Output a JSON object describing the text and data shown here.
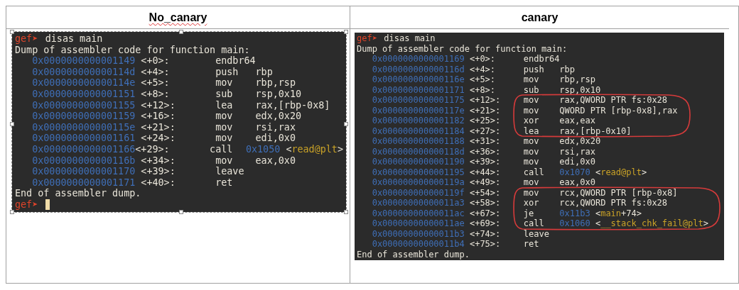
{
  "table": {
    "columns": [
      {
        "heading": "No_canary",
        "misspelled": true
      },
      {
        "heading": "canary",
        "misspelled": false
      }
    ],
    "panels": [
      {
        "lines": [
          {
            "kind": "prompt",
            "prompt": "gef➤",
            "command": "disas main"
          },
          {
            "kind": "text",
            "text": "Dump of assembler code for function main:"
          },
          {
            "kind": "instr",
            "addr": "0x0000000000001149",
            "offset": "<+0>:",
            "mnemonic": "endbr64"
          },
          {
            "kind": "instr",
            "addr": "0x000000000000114d",
            "offset": "<+4>:",
            "mnemonic": "push",
            "operands": "rbp"
          },
          {
            "kind": "instr",
            "addr": "0x000000000000114e",
            "offset": "<+5>:",
            "mnemonic": "mov",
            "operands": "rbp,rsp"
          },
          {
            "kind": "instr",
            "addr": "0x0000000000001151",
            "offset": "<+8>:",
            "mnemonic": "sub",
            "operands": "rsp,0x10"
          },
          {
            "kind": "instr",
            "addr": "0x0000000000001155",
            "offset": "<+12>:",
            "mnemonic": "lea",
            "operands": "rax,[rbp-0x8]"
          },
          {
            "kind": "instr",
            "addr": "0x0000000000001159",
            "offset": "<+16>:",
            "mnemonic": "mov",
            "operands": "edx,0x20"
          },
          {
            "kind": "instr",
            "addr": "0x000000000000115e",
            "offset": "<+21>:",
            "mnemonic": "mov",
            "operands": "rsi,rax"
          },
          {
            "kind": "instr",
            "addr": "0x0000000000001161",
            "offset": "<+24>:",
            "mnemonic": "mov",
            "operands": "edi,0x0"
          },
          {
            "kind": "instr",
            "addr": "0x0000000000001166",
            "offset": "<+29>:",
            "mnemonic": "call",
            "target": "0x1050",
            "ref_pre": "<",
            "ref_name": "read@plt",
            "ref_post": ">"
          },
          {
            "kind": "instr",
            "addr": "0x000000000000116b",
            "offset": "<+34>:",
            "mnemonic": "mov",
            "operands": "eax,0x0"
          },
          {
            "kind": "instr",
            "addr": "0x0000000000001170",
            "offset": "<+39>:",
            "mnemonic": "leave"
          },
          {
            "kind": "instr",
            "addr": "0x0000000000001171",
            "offset": "<+40>:",
            "mnemonic": "ret"
          },
          {
            "kind": "text",
            "text": "End of assembler dump."
          },
          {
            "kind": "prompt",
            "prompt": "gef➤",
            "cursor": true
          }
        ]
      },
      {
        "lines": [
          {
            "kind": "prompt",
            "prompt": "gef➤",
            "command": "disas main"
          },
          {
            "kind": "text",
            "text": "Dump of assembler code for function main:"
          },
          {
            "kind": "instr",
            "addr": "0x0000000000001169",
            "offset": "<+0>:",
            "mnemonic": "endbr64"
          },
          {
            "kind": "instr",
            "addr": "0x000000000000116d",
            "offset": "<+4>:",
            "mnemonic": "push",
            "operands": "rbp"
          },
          {
            "kind": "instr",
            "addr": "0x000000000000116e",
            "offset": "<+5>:",
            "mnemonic": "mov",
            "operands": "rbp,rsp"
          },
          {
            "kind": "instr",
            "addr": "0x0000000000001171",
            "offset": "<+8>:",
            "mnemonic": "sub",
            "operands": "rsp,0x10"
          },
          {
            "kind": "instr",
            "addr": "0x0000000000001175",
            "offset": "<+12>:",
            "mnemonic": "mov",
            "operands": "rax,QWORD PTR fs:0x28"
          },
          {
            "kind": "instr",
            "addr": "0x000000000000117e",
            "offset": "<+21>:",
            "mnemonic": "mov",
            "operands": "QWORD PTR [rbp-0x8],rax"
          },
          {
            "kind": "instr",
            "addr": "0x0000000000001182",
            "offset": "<+25>:",
            "mnemonic": "xor",
            "operands": "eax,eax"
          },
          {
            "kind": "instr",
            "addr": "0x0000000000001184",
            "offset": "<+27>:",
            "mnemonic": "lea",
            "operands": "rax,[rbp-0x10]"
          },
          {
            "kind": "instr",
            "addr": "0x0000000000001188",
            "offset": "<+31>:",
            "mnemonic": "mov",
            "operands": "edx,0x20"
          },
          {
            "kind": "instr",
            "addr": "0x000000000000118d",
            "offset": "<+36>:",
            "mnemonic": "mov",
            "operands": "rsi,rax"
          },
          {
            "kind": "instr",
            "addr": "0x0000000000001190",
            "offset": "<+39>:",
            "mnemonic": "mov",
            "operands": "edi,0x0"
          },
          {
            "kind": "instr",
            "addr": "0x0000000000001195",
            "offset": "<+44>:",
            "mnemonic": "call",
            "target": "0x1070",
            "ref_pre": "<",
            "ref_name": "read@plt",
            "ref_post": ">"
          },
          {
            "kind": "instr",
            "addr": "0x000000000000119a",
            "offset": "<+49>:",
            "mnemonic": "mov",
            "operands": "eax,0x0"
          },
          {
            "kind": "instr",
            "addr": "0x000000000000119f",
            "offset": "<+54>:",
            "mnemonic": "mov",
            "operands": "rcx,QWORD PTR [rbp-0x8]"
          },
          {
            "kind": "instr",
            "addr": "0x00000000000011a3",
            "offset": "<+58>:",
            "mnemonic": "xor",
            "operands": "rcx,QWORD PTR fs:0x28"
          },
          {
            "kind": "instr",
            "addr": "0x00000000000011ac",
            "offset": "<+67>:",
            "mnemonic": "je",
            "target": "0x11b3",
            "ref_pre": "<",
            "ref_name": "main",
            "ref_post": "+74>"
          },
          {
            "kind": "instr",
            "addr": "0x00000000000011ae",
            "offset": "<+69>:",
            "mnemonic": "call",
            "target": "0x1060",
            "ref_pre": "<",
            "ref_name": "__stack_chk_fail@plt",
            "ref_post": ">"
          },
          {
            "kind": "instr",
            "addr": "0x00000000000011b3",
            "offset": "<+74>:",
            "mnemonic": "leave"
          },
          {
            "kind": "instr",
            "addr": "0x00000000000011b4",
            "offset": "<+75>:",
            "mnemonic": "ret"
          },
          {
            "kind": "text",
            "text": "End of assembler dump."
          }
        ]
      }
    ]
  }
}
